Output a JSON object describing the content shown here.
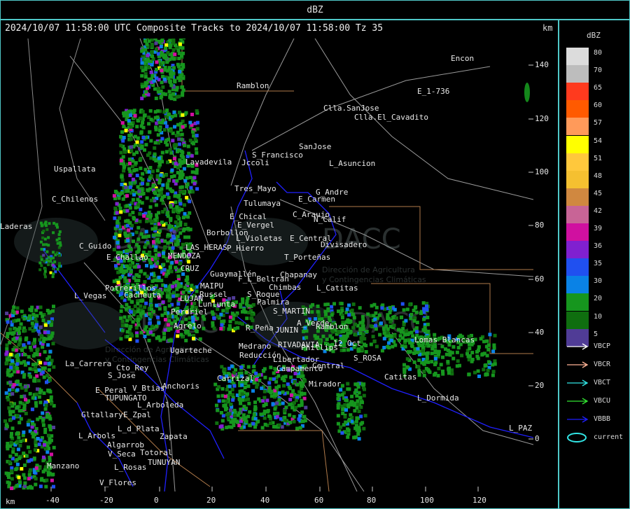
{
  "window_title": "dBZ",
  "header": "2024/10/07 11:58:00 UTC Composite Tracks to 2024/10/07 11:58:00 Tz 35",
  "axis_unit": "km",
  "y_ticks": [
    "140",
    "120",
    "100",
    "80",
    "60",
    "40",
    "20",
    "0"
  ],
  "x_ticks": [
    "-40",
    "-20",
    "0",
    "20",
    "40",
    "60",
    "80",
    "100",
    "120"
  ],
  "legend": {
    "title": "dBZ",
    "levels": [
      {
        "label": "80",
        "color": "#dcdcdc"
      },
      {
        "label": "70",
        "color": "#bdbdbd"
      },
      {
        "label": "65",
        "color": "#ff3a1e"
      },
      {
        "label": "60",
        "color": "#ff5a00"
      },
      {
        "label": "57",
        "color": "#ff9a5a"
      },
      {
        "label": "54",
        "color": "#ffff00"
      },
      {
        "label": "51",
        "color": "#ffc83c"
      },
      {
        "label": "48",
        "color": "#f5c030"
      },
      {
        "label": "45",
        "color": "#d08840"
      },
      {
        "label": "42",
        "color": "#c86496"
      },
      {
        "label": "39",
        "color": "#d010a0"
      },
      {
        "label": "36",
        "color": "#8020d0"
      },
      {
        "label": "35",
        "color": "#2050f0"
      },
      {
        "label": "30",
        "color": "#0a82e6"
      },
      {
        "label": "20",
        "color": "#16961e"
      },
      {
        "label": "10",
        "color": "#0f6e0f"
      },
      {
        "label": "5",
        "color": "#503c96"
      }
    ],
    "tracks": [
      {
        "label": "VBCP",
        "color": "#ffffff"
      },
      {
        "label": "VBCR",
        "color": "#ffb496"
      },
      {
        "label": "VBCT",
        "color": "#32e6e6"
      },
      {
        "label": "VBCU",
        "color": "#32e632"
      },
      {
        "label": "VBBB",
        "color": "#1e1eff"
      },
      {
        "label": "current",
        "color": "#32e6e6"
      }
    ]
  },
  "towns": [
    {
      "name": "Encon"
    },
    {
      "name": "E_1-736"
    },
    {
      "name": "Ramblon"
    },
    {
      "name": "Clla.SanJose"
    },
    {
      "name": "Clla.El_Cavadito"
    },
    {
      "name": "SanJose"
    },
    {
      "name": "S_Francisco"
    },
    {
      "name": "Jccoli"
    },
    {
      "name": "L_Asuncion"
    },
    {
      "name": "Uspallata"
    },
    {
      "name": "Lavadevila"
    },
    {
      "name": "Tres_Mayo"
    },
    {
      "name": "G_Andre"
    },
    {
      "name": "Tulumaya"
    },
    {
      "name": "E_Carmen"
    },
    {
      "name": "C_Chilenos"
    },
    {
      "name": "E_Chical"
    },
    {
      "name": "C_Araujo"
    },
    {
      "name": "N_Calif"
    },
    {
      "name": "E_Vergel"
    },
    {
      "name": "Borbollon"
    },
    {
      "name": "L_Violetas"
    },
    {
      "name": "E_Central"
    },
    {
      "name": "Divisadero"
    },
    {
      "name": "Laderas"
    },
    {
      "name": "C_Guido"
    },
    {
      "name": "LAS_HERAS"
    },
    {
      "name": "P_Hierro"
    },
    {
      "name": "E_Challao"
    },
    {
      "name": "MENDOZA"
    },
    {
      "name": "T_Porteñas"
    },
    {
      "name": "CRUZ"
    },
    {
      "name": "Guaymallén"
    },
    {
      "name": "Chapanay"
    },
    {
      "name": "MAIPU"
    },
    {
      "name": "F_L_Beltran"
    },
    {
      "name": "Potrerillos"
    },
    {
      "name": "Chimbas"
    },
    {
      "name": "L_Catitas"
    },
    {
      "name": "L_Vegas"
    },
    {
      "name": "Cacheuta"
    },
    {
      "name": "Russel"
    },
    {
      "name": "S_Roque"
    },
    {
      "name": "LUJAN"
    },
    {
      "name": "Lunlunta"
    },
    {
      "name": "Palmira"
    },
    {
      "name": "Perdriel"
    },
    {
      "name": "S_MARTIN"
    },
    {
      "name": "Agrelo"
    },
    {
      "name": "R_Peña"
    },
    {
      "name": "JUNIN"
    },
    {
      "name": "A_Verde"
    },
    {
      "name": "Ramblon"
    },
    {
      "name": "Lomas_Blancas"
    },
    {
      "name": "RIVADAVIA"
    },
    {
      "name": "Phillips"
    },
    {
      "name": "12_Oct"
    },
    {
      "name": "Medrano"
    },
    {
      "name": "Reducción"
    },
    {
      "name": "Libertador"
    },
    {
      "name": "La_Carrera"
    },
    {
      "name": "Ugarteche"
    },
    {
      "name": "S_ROSA"
    },
    {
      "name": "Cto_Rey"
    },
    {
      "name": "Central"
    },
    {
      "name": "Campamento"
    },
    {
      "name": "Catitas"
    },
    {
      "name": "S_Jose"
    },
    {
      "name": "Carrizal"
    },
    {
      "name": "Mirador"
    },
    {
      "name": "E_Peral"
    },
    {
      "name": "V_Btias"
    },
    {
      "name": "Anchoris"
    },
    {
      "name": "TUPUNGATO"
    },
    {
      "name": "L_Arboleda"
    },
    {
      "name": "L_Dormida"
    },
    {
      "name": "Gltallary"
    },
    {
      "name": "E_Zpal"
    },
    {
      "name": "L_d_Plata"
    },
    {
      "name": "L_PAZ"
    },
    {
      "name": "L_Arbols"
    },
    {
      "name": "Zapata"
    },
    {
      "name": "Algarrob"
    },
    {
      "name": "V_Seca"
    },
    {
      "name": "Totoral"
    },
    {
      "name": "Manzano"
    },
    {
      "name": "L_Rosas"
    },
    {
      "name": "TUNUYAN"
    },
    {
      "name": "V_Flores"
    }
  ],
  "watermark": {
    "name": "DACC",
    "subtitle_1": "Dirección de Agricultura",
    "subtitle_2": "y Contingencias Climáticas"
  }
}
